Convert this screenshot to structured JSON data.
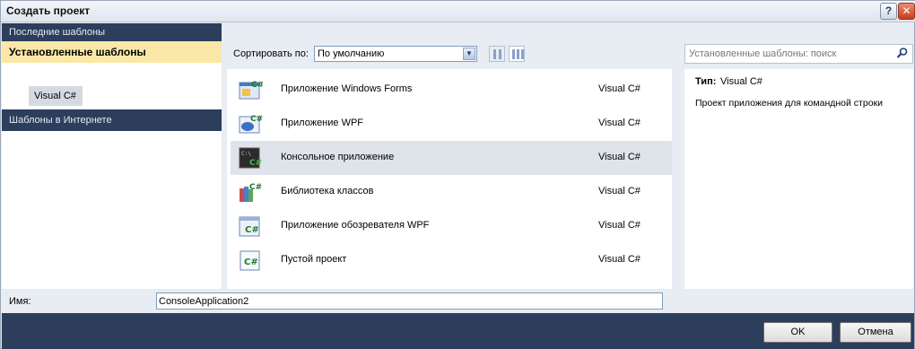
{
  "window": {
    "title": "Создать проект",
    "help_glyph": "?",
    "close_glyph": "✕"
  },
  "sidebar": {
    "items": [
      {
        "label": "Последние шаблоны"
      },
      {
        "label": "Установленные шаблоны"
      },
      {
        "label": "Visual C#"
      },
      {
        "label": "Шаблоны в Интернете"
      }
    ]
  },
  "sort": {
    "label": "Сортировать по:",
    "value": "По умолчанию"
  },
  "search": {
    "placeholder": "Установленные шаблоны: поиск"
  },
  "templates": [
    {
      "name": "Приложение Windows Forms",
      "lang": "Visual C#",
      "icon": "windows-forms-icon"
    },
    {
      "name": "Приложение WPF",
      "lang": "Visual C#",
      "icon": "wpf-icon"
    },
    {
      "name": "Консольное приложение",
      "lang": "Visual C#",
      "icon": "console-icon",
      "selected": true
    },
    {
      "name": "Библиотека классов",
      "lang": "Visual C#",
      "icon": "class-library-icon"
    },
    {
      "name": "Приложение обозревателя WPF",
      "lang": "Visual C#",
      "icon": "wpf-browser-icon"
    },
    {
      "name": "Пустой проект",
      "lang": "Visual C#",
      "icon": "empty-project-icon"
    }
  ],
  "details": {
    "type_label": "Тип:",
    "type_value": "Visual C#",
    "description": "Проект приложения для командной строки"
  },
  "name_field": {
    "label": "Имя:",
    "value": "ConsoleApplication2"
  },
  "buttons": {
    "ok": "OK",
    "cancel": "Отмена"
  },
  "colors": {
    "nav_dark": "#2c3e5c",
    "selected_nav": "#fbe8a8",
    "row_selected": "#dfe3ea"
  }
}
